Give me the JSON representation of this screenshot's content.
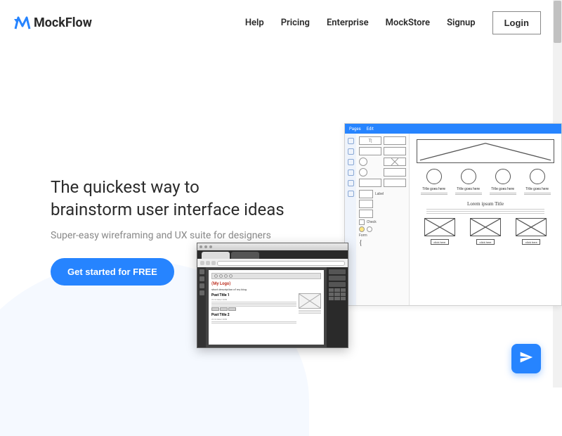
{
  "brand": {
    "name": "MockFlow"
  },
  "nav": {
    "help": "Help",
    "pricing": "Pricing",
    "enterprise": "Enterprise",
    "mockstore": "MockStore",
    "signup": "Signup",
    "login": "Login"
  },
  "hero": {
    "title_line1": "The quickest way to",
    "title_line2": "brainstorm user interface ideas",
    "subtitle": "Super-easy wireframing and UX suite for designers",
    "cta": "Get started for FREE"
  },
  "mockup_wireframe": {
    "toolbar": {
      "item1": "Pages",
      "item2": "Edit"
    },
    "caption": "Title goes here",
    "section_title": "Lorem ipsum Title",
    "card_button": "click here",
    "sidebar_labels": {
      "label": "Label",
      "check": "Check",
      "form": "Form"
    }
  },
  "mockup_browser": {
    "logo": "(My Logo)",
    "tagline": "short description of my blog",
    "post1": "Post Title 1",
    "post2": "Post Title 2",
    "date": "22 October 2009"
  },
  "colors": {
    "primary": "#2684ff"
  }
}
